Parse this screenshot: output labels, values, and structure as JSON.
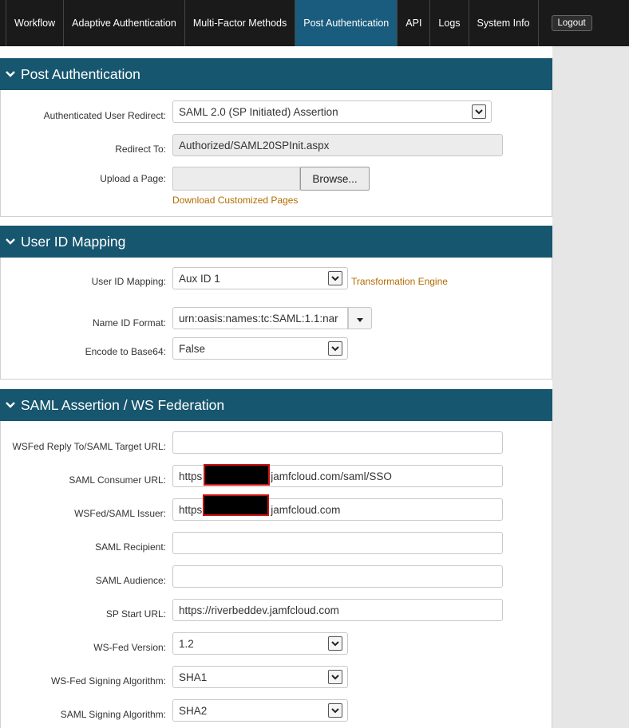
{
  "nav": {
    "items": [
      {
        "label": "Workflow"
      },
      {
        "label": "Adaptive Authentication"
      },
      {
        "label": "Multi-Factor Methods"
      },
      {
        "label": "Post Authentication"
      },
      {
        "label": "API"
      },
      {
        "label": "Logs"
      },
      {
        "label": "System Info"
      }
    ],
    "active": "Post Authentication",
    "logout_label": "Logout"
  },
  "post_auth": {
    "title": "Post Authentication",
    "redirect_label": "Authenticated User Redirect:",
    "redirect_value": "SAML 2.0 (SP Initiated) Assertion",
    "redirect_to_label": "Redirect To:",
    "redirect_to_value": "Authorized/SAML20SPInit.aspx",
    "upload_label": "Upload a Page:",
    "browse_label": "Browse...",
    "download_link": "Download Customized Pages"
  },
  "user_id_mapping": {
    "title": "User ID Mapping",
    "mapping_label": "User ID Mapping:",
    "mapping_value": "Aux ID 1",
    "transformation_link": "Transformation Engine",
    "name_id_label": "Name ID Format:",
    "name_id_value": "urn:oasis:names:tc:SAML:1.1:nar",
    "encode_label": "Encode to Base64:",
    "encode_value": "False"
  },
  "saml": {
    "title": "SAML Assertion / WS Federation",
    "reply_label": "WSFed Reply To/SAML Target URL:",
    "reply_value": "",
    "consumer_label": "SAML Consumer URL:",
    "consumer_prefix": "https",
    "consumer_suffix": "jamfcloud.com/saml/SSO",
    "issuer_label": "WSFed/SAML Issuer:",
    "issuer_prefix": "https",
    "issuer_suffix": "jamfcloud.com",
    "recipient_label": "SAML Recipient:",
    "recipient_value": "",
    "audience_label": "SAML Audience:",
    "audience_value": "",
    "sp_start_label": "SP Start URL:",
    "sp_start_value": "https://riverbeddev.jamfcloud.com",
    "wsfed_version_label": "WS-Fed Version:",
    "wsfed_version_value": "1.2",
    "wsfed_sign_label": "WS-Fed Signing Algorithm:",
    "wsfed_sign_value": "SHA1",
    "saml_sign_label": "SAML Signing Algorithm:",
    "saml_sign_value": "SHA2"
  },
  "colors": {
    "nav_bg": "#1a1a1a",
    "nav_active": "#1a5c7d",
    "panel_header": "#17566f",
    "link": "#b36b00"
  }
}
